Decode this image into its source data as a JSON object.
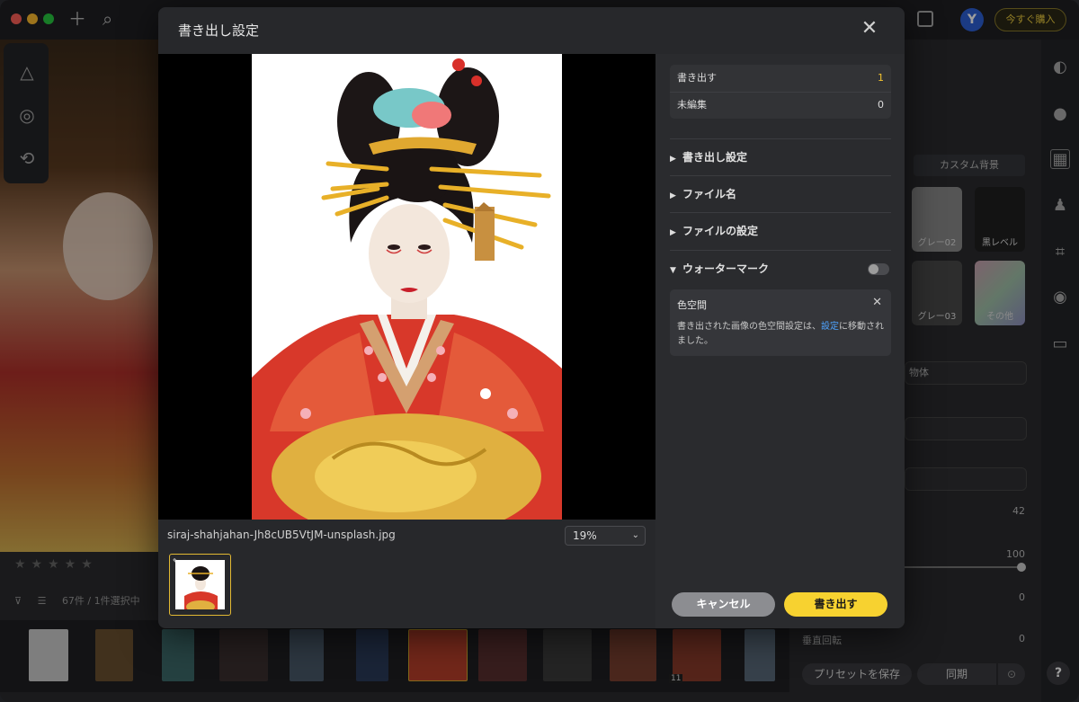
{
  "app": {
    "buy_label": "今すぐ購入",
    "avatar_initial": "Y",
    "rating_stars": "★★★★★",
    "filter_count": "67件 / 1件選択中",
    "film_badge": "11",
    "right_panel": {
      "custom_bg_tab": "カスタム背景",
      "swatches": [
        "グレー02",
        "黒レベル",
        "グレー03",
        "その他"
      ],
      "select_1": "物体",
      "value_1": "42",
      "value_2": "100",
      "value_3": "0",
      "flip_label": "垂直回転",
      "flip_value": "0",
      "preset_label": "プリセットを保存",
      "sync_label": "同期",
      "help_label": "?"
    }
  },
  "dialog": {
    "title": "書き出し設定",
    "file_name": "siraj-shahjahan-Jh8cUB5VtJM-unsplash.jpg",
    "zoom": "19%",
    "counts": [
      {
        "label": "書き出す",
        "value": "1"
      },
      {
        "label": "未編集",
        "value": "0"
      }
    ],
    "sections": [
      {
        "label": "書き出し設定",
        "expanded": false
      },
      {
        "label": "ファイル名",
        "expanded": false
      },
      {
        "label": "ファイルの設定",
        "expanded": false
      },
      {
        "label": "ウォーターマーク",
        "expanded": true
      }
    ],
    "notice": {
      "title": "色空間",
      "body_before": "書き出された画像の色空間設定は、",
      "link": "設定",
      "body_after": "に移動されました。"
    },
    "cancel_label": "キャンセル",
    "export_label": "書き出す"
  },
  "colors": {
    "accent": "#f7d230",
    "count_highlight": "#f2c230",
    "link": "#4ea3ff"
  }
}
